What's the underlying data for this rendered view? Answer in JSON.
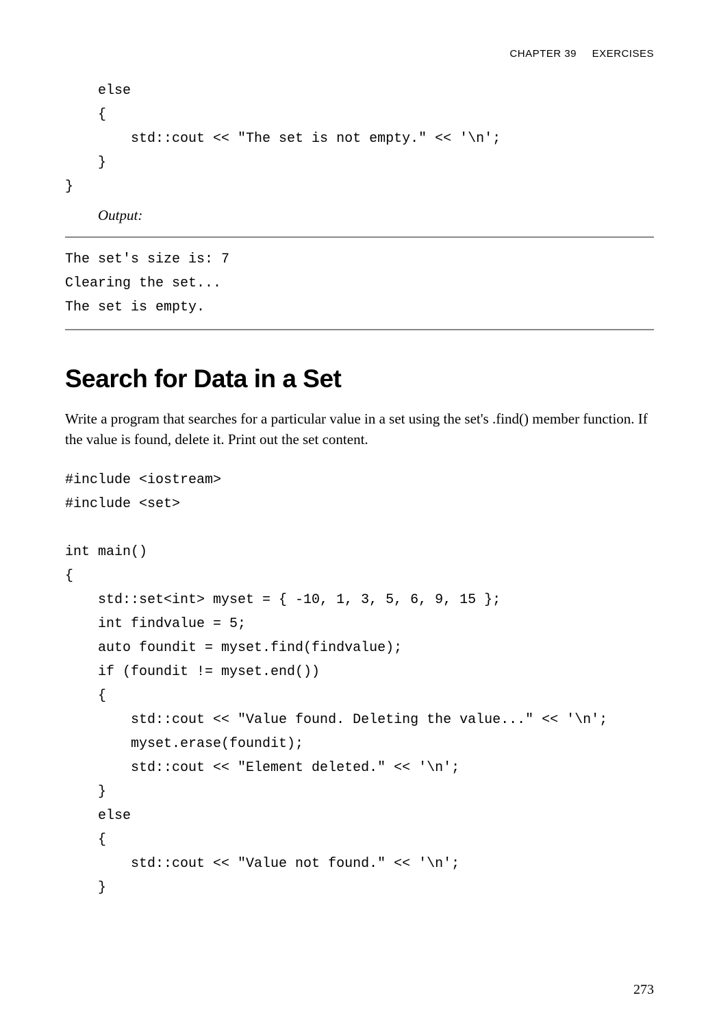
{
  "header": {
    "chapter": "CHAPTER 39",
    "title": "EXERCISES"
  },
  "code1": "    else\n    {\n        std::cout << \"The set is not empty.\" << '\\n';\n    }\n}",
  "outputLabel": "Output:",
  "outputText": "The set's size is: 7\nClearing the set...\nThe set is empty.",
  "heading": "Search for Data in a Set",
  "bodyText": "Write a program that searches for a particular value in a set using the set's .find() member function. If the value is found, delete it. Print out the set content.",
  "code2": "#include <iostream>\n#include <set>\n\nint main()\n{\n    std::set<int> myset = { -10, 1, 3, 5, 6, 9, 15 };\n    int findvalue = 5;\n    auto foundit = myset.find(findvalue);\n    if (foundit != myset.end())\n    {\n        std::cout << \"Value found. Deleting the value...\" << '\\n';\n        myset.erase(foundit);\n        std::cout << \"Element deleted.\" << '\\n';\n    }\n    else\n    {\n        std::cout << \"Value not found.\" << '\\n';\n    }",
  "pageNumber": "273"
}
